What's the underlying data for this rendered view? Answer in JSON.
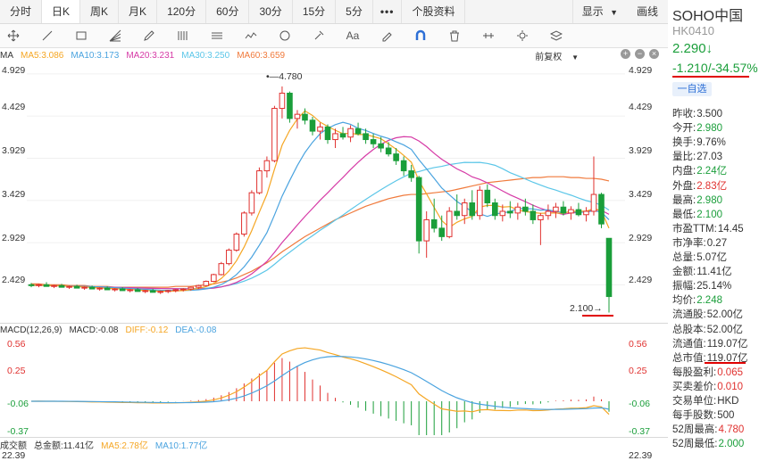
{
  "tabs": {
    "items": [
      "分时",
      "日K",
      "周K",
      "月K",
      "120分",
      "60分",
      "30分",
      "15分",
      "5分"
    ],
    "active_index": 1,
    "more": "•••",
    "info": "个股资料",
    "display": "显示",
    "draw": "画线"
  },
  "toolbar": {
    "icons": [
      "move-icon",
      "line-icon",
      "rect-icon",
      "fan-icon",
      "pen-icon",
      "bars-icon",
      "channel-icon",
      "wave-icon",
      "cycle-icon",
      "tool-icon",
      "text-icon",
      "brush-icon",
      "magnet-icon",
      "trash-icon",
      "range-icon",
      "settings-icon",
      "layers-icon"
    ],
    "text_label": "Aa"
  },
  "ma": {
    "label": "MA",
    "ma5": "MA5:3.086",
    "ma10": "MA10:3.173",
    "ma20": "MA20:3.231",
    "ma30": "MA30:3.250",
    "ma60": "MA60:3.659",
    "restore": "前复权",
    "colors": {
      "ma5": "#f5a623",
      "ma10": "#4aa3df",
      "ma20": "#d63aa6",
      "ma30": "#5bc6e8",
      "ma60": "#f07a3c"
    }
  },
  "price_axis": [
    "4.929",
    "4.429",
    "3.929",
    "3.429",
    "2.929",
    "2.429"
  ],
  "annotations": {
    "high": "4.780",
    "low": "2.100"
  },
  "macd": {
    "label": "MACD(12,26,9)",
    "macd": "MACD:-0.08",
    "diff": "DIFF:-0.12",
    "dea": "DEA:-0.08",
    "axis": [
      "0.56",
      "0.25",
      "-0.06",
      "-0.37"
    ]
  },
  "volume": {
    "label": "成交额",
    "total": "总金额:11.41亿",
    "ma5": "MA5:2.78亿",
    "ma10": "MA10:1.77亿",
    "axis": "22.39"
  },
  "chart_data": {
    "type": "candlestick",
    "ylim": [
      2.0,
      4.98
    ],
    "candles": [
      [
        2.43,
        2.45,
        2.4,
        2.42
      ],
      [
        2.42,
        2.44,
        2.4,
        2.43
      ],
      [
        2.43,
        2.46,
        2.41,
        2.41
      ],
      [
        2.41,
        2.43,
        2.39,
        2.42
      ],
      [
        2.42,
        2.44,
        2.4,
        2.4
      ],
      [
        2.4,
        2.42,
        2.38,
        2.41
      ],
      [
        2.41,
        2.43,
        2.39,
        2.39
      ],
      [
        2.39,
        2.41,
        2.37,
        2.4
      ],
      [
        2.4,
        2.42,
        2.38,
        2.38
      ],
      [
        2.38,
        2.4,
        2.36,
        2.39
      ],
      [
        2.39,
        2.41,
        2.37,
        2.37
      ],
      [
        2.37,
        2.39,
        2.35,
        2.38
      ],
      [
        2.38,
        2.4,
        2.36,
        2.36
      ],
      [
        2.36,
        2.38,
        2.34,
        2.37
      ],
      [
        2.37,
        2.39,
        2.35,
        2.35
      ],
      [
        2.35,
        2.37,
        2.33,
        2.36
      ],
      [
        2.36,
        2.38,
        2.34,
        2.34
      ],
      [
        2.34,
        2.36,
        2.32,
        2.35
      ],
      [
        2.35,
        2.37,
        2.33,
        2.36
      ],
      [
        2.36,
        2.38,
        2.34,
        2.37
      ],
      [
        2.37,
        2.39,
        2.35,
        2.38
      ],
      [
        2.38,
        2.41,
        2.36,
        2.4
      ],
      [
        2.4,
        2.43,
        2.38,
        2.42
      ],
      [
        2.42,
        2.48,
        2.41,
        2.47
      ],
      [
        2.47,
        2.56,
        2.46,
        2.55
      ],
      [
        2.55,
        2.7,
        2.54,
        2.68
      ],
      [
        2.68,
        2.86,
        2.66,
        2.84
      ],
      [
        2.84,
        3.05,
        2.82,
        3.03
      ],
      [
        3.03,
        3.3,
        3.0,
        3.28
      ],
      [
        3.28,
        3.55,
        3.25,
        3.52
      ],
      [
        3.52,
        3.82,
        3.5,
        3.78
      ],
      [
        3.78,
        3.95,
        3.7,
        3.9
      ],
      [
        3.9,
        4.55,
        3.88,
        4.52
      ],
      [
        4.52,
        4.78,
        4.4,
        4.7
      ],
      [
        4.7,
        4.72,
        4.35,
        4.4
      ],
      [
        4.4,
        4.5,
        4.28,
        4.45
      ],
      [
        4.45,
        4.52,
        4.33,
        4.38
      ],
      [
        4.38,
        4.42,
        4.2,
        4.25
      ],
      [
        4.25,
        4.35,
        4.15,
        4.3
      ],
      [
        4.3,
        4.33,
        4.1,
        4.15
      ],
      [
        4.15,
        4.28,
        4.05,
        4.22
      ],
      [
        4.22,
        4.3,
        4.15,
        4.18
      ],
      [
        4.18,
        4.32,
        4.12,
        4.28
      ],
      [
        4.28,
        4.35,
        4.2,
        4.22
      ],
      [
        4.22,
        4.28,
        4.1,
        4.15
      ],
      [
        4.15,
        4.22,
        4.05,
        4.1
      ],
      [
        4.1,
        4.18,
        4.0,
        4.05
      ],
      [
        4.05,
        4.12,
        3.95,
        3.98
      ],
      [
        3.98,
        4.05,
        3.85,
        3.9
      ],
      [
        3.9,
        3.95,
        3.72,
        3.78
      ],
      [
        3.78,
        3.85,
        3.65,
        3.7
      ],
      [
        3.7,
        3.72,
        2.8,
        2.95
      ],
      [
        2.95,
        3.3,
        2.75,
        3.2
      ],
      [
        3.2,
        3.45,
        3.05,
        3.1
      ],
      [
        3.1,
        3.25,
        2.95,
        3.0
      ],
      [
        3.0,
        3.35,
        2.98,
        3.3
      ],
      [
        3.3,
        3.5,
        3.2,
        3.25
      ],
      [
        3.25,
        3.45,
        3.15,
        3.4
      ],
      [
        3.4,
        3.55,
        3.2,
        3.25
      ],
      [
        3.25,
        3.6,
        3.2,
        3.55
      ],
      [
        3.55,
        3.62,
        3.35,
        3.4
      ],
      [
        3.4,
        3.45,
        3.2,
        3.25
      ],
      [
        3.25,
        3.38,
        3.18,
        3.3
      ],
      [
        3.3,
        3.42,
        3.22,
        3.28
      ],
      [
        3.28,
        3.4,
        3.2,
        3.35
      ],
      [
        3.35,
        3.45,
        3.25,
        3.3
      ],
      [
        3.3,
        3.38,
        3.15,
        3.2
      ],
      [
        3.2,
        3.28,
        2.9,
        3.25
      ],
      [
        3.25,
        3.38,
        3.2,
        3.3
      ],
      [
        3.3,
        3.4,
        3.22,
        3.35
      ],
      [
        3.35,
        3.42,
        3.25,
        3.28
      ],
      [
        3.28,
        3.36,
        3.2,
        3.32
      ],
      [
        3.32,
        3.4,
        3.24,
        3.26
      ],
      [
        3.26,
        3.35,
        3.18,
        3.3
      ],
      [
        3.3,
        3.95,
        3.25,
        3.5
      ],
      [
        3.5,
        3.52,
        3.1,
        3.15
      ],
      [
        2.98,
        2.98,
        2.1,
        2.29
      ]
    ],
    "ma60": [
      2.44,
      2.44,
      2.43,
      2.43,
      2.43,
      2.42,
      2.42,
      2.42,
      2.41,
      2.41,
      2.41,
      2.4,
      2.4,
      2.4,
      2.4,
      2.4,
      2.4,
      2.4,
      2.4,
      2.41,
      2.41,
      2.41,
      2.42,
      2.43,
      2.44,
      2.46,
      2.48,
      2.51,
      2.55,
      2.59,
      2.64,
      2.69,
      2.75,
      2.82,
      2.88,
      2.94,
      3.0,
      3.05,
      3.1,
      3.15,
      3.2,
      3.24,
      3.28,
      3.32,
      3.36,
      3.39,
      3.42,
      3.45,
      3.47,
      3.49,
      3.5,
      3.5,
      3.51,
      3.52,
      3.53,
      3.54,
      3.56,
      3.58,
      3.6,
      3.62,
      3.64,
      3.65,
      3.66,
      3.67,
      3.68,
      3.69,
      3.7,
      3.7,
      3.71,
      3.71,
      3.71,
      3.7,
      3.7,
      3.69,
      3.69,
      3.68,
      3.66
    ],
    "macd_axis": [
      0.56,
      -0.37
    ]
  },
  "sidebar": {
    "name": "SOHO中国",
    "code": "HK0410",
    "price": "2.290↓",
    "change": "-1.210/-34.57%",
    "watch": "一自选",
    "rows": [
      {
        "label": "昨收:",
        "value": "3.500",
        "cls": ""
      },
      {
        "label": "今开:",
        "value": "2.980",
        "cls": "green"
      },
      {
        "label": "换手:",
        "value": "9.76%",
        "cls": ""
      },
      {
        "label": "量比:",
        "value": "27.03",
        "cls": ""
      },
      {
        "label": "内盘:",
        "value": "2.24亿",
        "cls": "green"
      },
      {
        "label": "外盘:",
        "value": "2.83亿",
        "cls": "red"
      },
      {
        "label": "最高:",
        "value": "2.980",
        "cls": "green"
      },
      {
        "label": "最低:",
        "value": "2.100",
        "cls": "green"
      },
      {
        "label": "市盈TTM:",
        "value": "14.45",
        "cls": ""
      },
      {
        "label": "市净率:",
        "value": "0.27",
        "cls": ""
      },
      {
        "label": "总量:",
        "value": "5.07亿",
        "cls": ""
      },
      {
        "label": "金额:",
        "value": "11.41亿",
        "cls": ""
      },
      {
        "label": "振幅:",
        "value": "25.14%",
        "cls": ""
      },
      {
        "label": "均价:",
        "value": "2.248",
        "cls": "green"
      },
      {
        "label": "流通股:",
        "value": "52.00亿",
        "cls": ""
      },
      {
        "label": "总股本:",
        "value": "52.00亿",
        "cls": ""
      },
      {
        "label": "流通值:",
        "value": "119.07亿",
        "cls": ""
      },
      {
        "label": "总市值:",
        "value": "119.07亿",
        "cls": ""
      },
      {
        "label": "每股盈利:",
        "value": "0.065",
        "cls": "red"
      },
      {
        "label": "买卖差价:",
        "value": "0.010",
        "cls": "red"
      },
      {
        "label": "交易单位:",
        "value": "HKD",
        "cls": ""
      },
      {
        "label": "每手股数:",
        "value": "500",
        "cls": ""
      },
      {
        "label": "52周最高:",
        "value": "4.780",
        "cls": "red"
      },
      {
        "label": "52周最低:",
        "value": "2.000",
        "cls": "green"
      }
    ]
  }
}
